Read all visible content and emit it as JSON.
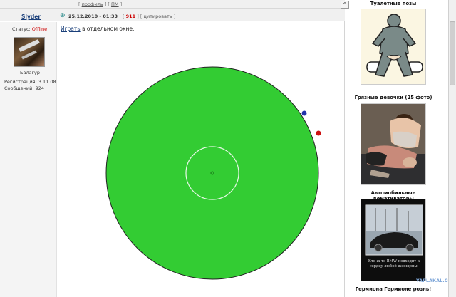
{
  "top_bar": {
    "links": [
      "[",
      "профиль",
      "] [",
      "ПМ",
      "]"
    ]
  },
  "post": {
    "username": "Slyder",
    "date": "25.12.2010 - 01:33",
    "post_number": "911",
    "quote_label": "цитировать",
    "user": {
      "status_label": "Статус:",
      "status_value": "Offline",
      "rank": "Балагур",
      "registration": "Регистрация: 3.11.08",
      "messages": "Сообщений: 924"
    },
    "body": {
      "play_link": "Играть",
      "play_rest": "в отдельном окне."
    }
  },
  "game": {
    "field_color": "#33cc33",
    "outline_color": "#222222",
    "inner_ring_color": "#e8f8e8",
    "player_blue": "#2233aa",
    "player_red": "#cc1111"
  },
  "sidebar": {
    "collapse_glyph": "^",
    "items": [
      {
        "title": "Туалетные позы"
      },
      {
        "title": "Грязные девочки (25 фото)"
      },
      {
        "title": "Автомобильные демативаторы"
      },
      {
        "title": "Гермиона Гермионе рознь!"
      }
    ],
    "bmw_caption": "Кто-ж то BMW подходит к сердцу любой женщины.",
    "watermark": "YAPLAKAL.COM"
  }
}
